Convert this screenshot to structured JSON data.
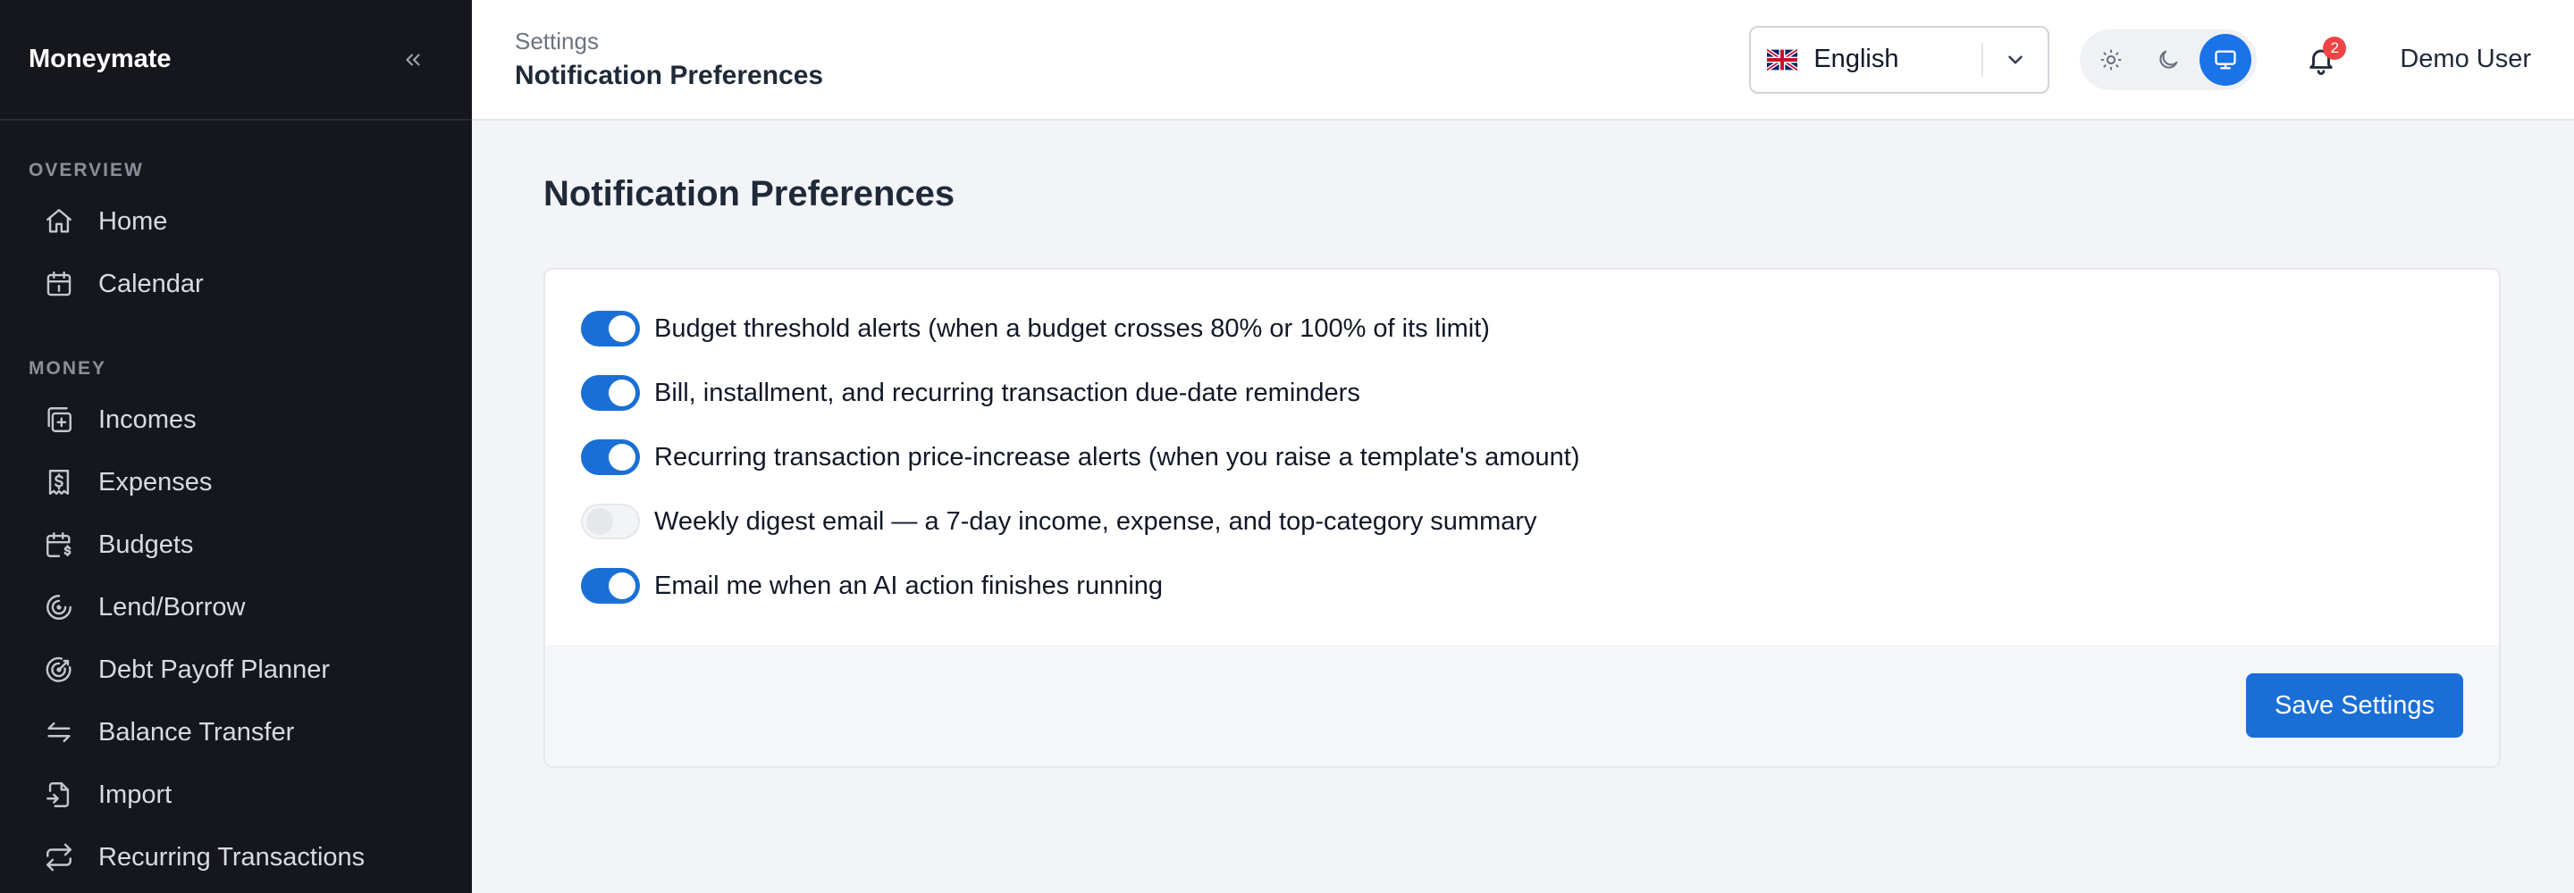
{
  "app": {
    "brand": "Moneymate"
  },
  "sidebar": {
    "sections": [
      {
        "label": "OVERVIEW",
        "items": [
          {
            "label": "Home",
            "icon": "home-icon"
          },
          {
            "label": "Calendar",
            "icon": "calendar-icon"
          }
        ]
      },
      {
        "label": "MONEY",
        "items": [
          {
            "label": "Incomes",
            "icon": "incomes-icon"
          },
          {
            "label": "Expenses",
            "icon": "expenses-icon"
          },
          {
            "label": "Budgets",
            "icon": "budgets-icon"
          },
          {
            "label": "Lend/Borrow",
            "icon": "lend-borrow-icon"
          },
          {
            "label": "Debt Payoff Planner",
            "icon": "target-icon"
          },
          {
            "label": "Balance Transfer",
            "icon": "transfer-icon"
          },
          {
            "label": "Import",
            "icon": "import-icon"
          },
          {
            "label": "Recurring Transactions",
            "icon": "recurring-icon"
          }
        ]
      }
    ]
  },
  "header": {
    "breadcrumb_parent": "Settings",
    "breadcrumb_current": "Notification Preferences",
    "language": {
      "selected": "English",
      "flag": "uk-flag-icon"
    },
    "theme": {
      "active": "system"
    },
    "notifications_count": "2",
    "user_name": "Demo User"
  },
  "main": {
    "title": "Notification Preferences",
    "preferences": [
      {
        "label": "Budget threshold alerts (when a budget crosses 80% or 100% of its limit)",
        "enabled": true
      },
      {
        "label": "Bill, installment, and recurring transaction due-date reminders",
        "enabled": true
      },
      {
        "label": "Recurring transaction price-increase alerts (when you raise a template's amount)",
        "enabled": true
      },
      {
        "label": "Weekly digest email — a 7-day income, expense, and top-category summary",
        "enabled": false
      },
      {
        "label": "Email me when an AI action finishes running",
        "enabled": true
      }
    ],
    "save_label": "Save Settings"
  },
  "colors": {
    "accent": "#1a6fd6",
    "sidebar_bg": "#16171d",
    "badge": "#ef4444"
  }
}
